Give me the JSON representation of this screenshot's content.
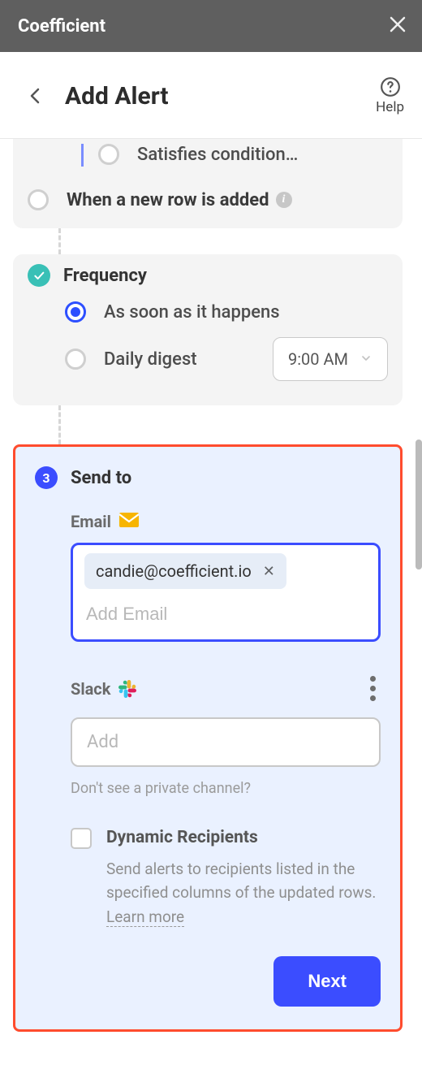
{
  "titlebar": {
    "title": "Coefficient"
  },
  "header": {
    "title": "Add Alert",
    "help": "Help"
  },
  "triggers": {
    "satisfies": "Satisfies condition…",
    "new_row": "When a new row is added"
  },
  "frequency": {
    "title": "Frequency",
    "option_instant": "As soon as it happens",
    "option_digest": "Daily digest",
    "digest_time": "9:00 AM"
  },
  "sendto": {
    "step": "3",
    "title": "Send to",
    "email_label": "Email",
    "email_chips": [
      "candie@coefficient.io"
    ],
    "email_placeholder": "Add Email",
    "slack_label": "Slack",
    "slack_placeholder": "Add",
    "slack_hint": "Don't see a private channel?",
    "dynamic_title": "Dynamic Recipients",
    "dynamic_desc": "Send alerts to recipients listed in the specified columns of the updated rows. ",
    "learn_more": "Learn more",
    "next": "Next"
  }
}
